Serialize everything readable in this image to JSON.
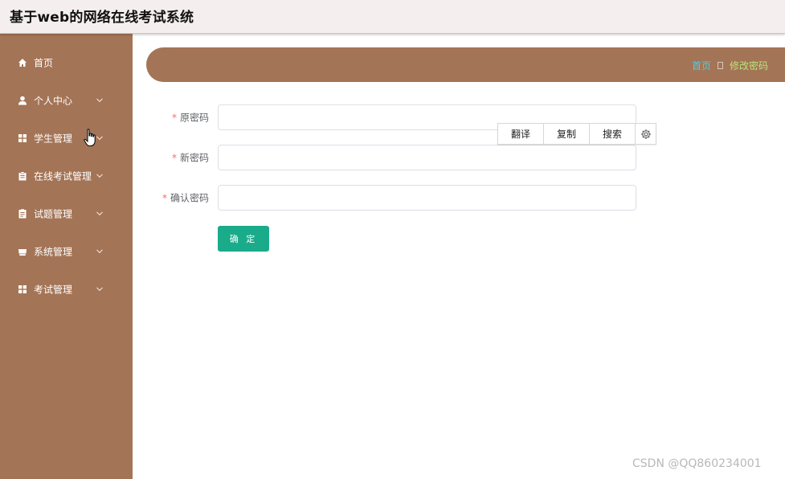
{
  "app": {
    "title": "基于web的网络在线考试系统"
  },
  "sidebar": {
    "items": [
      {
        "label": "首页",
        "icon": "home-icon",
        "has_submenu": false
      },
      {
        "label": "个人中心",
        "icon": "user-icon",
        "has_submenu": true
      },
      {
        "label": "学生管理",
        "icon": "grid-icon",
        "has_submenu": true
      },
      {
        "label": "在线考试管理",
        "icon": "clipboard-icon",
        "has_submenu": true
      },
      {
        "label": "试题管理",
        "icon": "document-icon",
        "has_submenu": true
      },
      {
        "label": "系统管理",
        "icon": "archive-icon",
        "has_submenu": true
      },
      {
        "label": "考试管理",
        "icon": "grid-icon",
        "has_submenu": true
      }
    ]
  },
  "breadcrumb": {
    "home": "首页",
    "current": "修改密码"
  },
  "form": {
    "old_password": {
      "label": "原密码",
      "value": "",
      "placeholder": ""
    },
    "new_password": {
      "label": "新密码",
      "value": "",
      "placeholder": ""
    },
    "confirm_password": {
      "label": "确认密码",
      "value": "",
      "placeholder": ""
    },
    "required_mark": "*",
    "submit_label": "确 定"
  },
  "float_toolbar": {
    "translate": "翻译",
    "copy": "复制",
    "search": "搜索"
  },
  "watermark": "CSDN @QQ860234001",
  "colors": {
    "sidebar_bg": "#a47456",
    "header_bg": "#f4efee",
    "button_bg": "#1aab8a",
    "breadcrumb_home": "#48d1e8",
    "breadcrumb_current": "#b9e27a",
    "required": "#f56c6c"
  }
}
